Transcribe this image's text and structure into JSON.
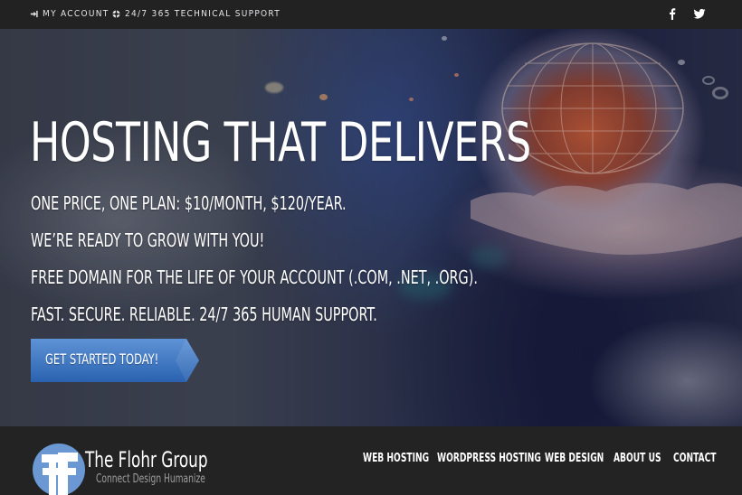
{
  "topbar": {
    "account": {
      "icon": "sign-in-icon",
      "label": "MY ACCOUNT"
    },
    "support": {
      "icon": "life-ring-icon",
      "label": "24/7 365 TECHNICAL SUPPORT"
    },
    "social": [
      {
        "name": "facebook",
        "icon": "facebook-icon"
      },
      {
        "name": "twitter",
        "icon": "twitter-icon"
      }
    ]
  },
  "hero": {
    "title": "HOSTING THAT DELIVERS",
    "lines": [
      "ONE PRICE, ONE PLAN: $10/MONTH, $120/YEAR.",
      "WE’RE READY TO GROW WITH YOU!",
      "FREE DOMAIN FOR THE LIFE OF YOUR ACCOUNT (.COM, .NET, .ORG).",
      "FAST. SECURE. RELIABLE. 24/7 365 HUMAN SUPPORT."
    ],
    "cta_label": "GET STARTED TODAY!"
  },
  "brand": {
    "name": "The Flohr Group",
    "tagline": "Connect Design Humanize",
    "mark_letters": "FF",
    "accent_color": "#6b97d3"
  },
  "nav": {
    "items": [
      {
        "label": "WEB HOSTING"
      },
      {
        "label": "WORDPRESS HOSTING"
      },
      {
        "label": "WEB DESIGN"
      },
      {
        "label": "ABOUT US"
      },
      {
        "label": "CONTACT"
      }
    ]
  },
  "colors": {
    "topbar_bg": "#222222",
    "navbar_bg": "#232323",
    "cta_blue": "#3b78c4"
  }
}
